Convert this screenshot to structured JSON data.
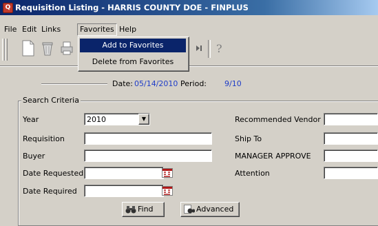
{
  "window": {
    "title": "Requisition Listing - HARRIS COUNTY DOE - FINPLUS",
    "app_icon": "finplus-app-icon"
  },
  "menubar": {
    "items": [
      "File",
      "Edit",
      "Links",
      "Favorites",
      "Help"
    ],
    "open_menu": "Favorites"
  },
  "favorites_menu": {
    "items": [
      "Add to Favorites",
      "Delete from Favorites"
    ],
    "highlighted": "Add to Favorites"
  },
  "toolbar": {
    "icons": [
      "new-document-icon",
      "trash-icon",
      "print-icon",
      "last-record-icon",
      "help-question-icon"
    ]
  },
  "info": {
    "date_label": "Date:",
    "date_value": "05/14/2010",
    "period_label": "Period:",
    "period_value": "9/10"
  },
  "search": {
    "group_title": "Search Criteria",
    "year_label": "Year",
    "year_value": "2010",
    "requisition_label": "Requisition",
    "requisition_value": "",
    "buyer_label": "Buyer",
    "buyer_value": "",
    "date_requested_label": "Date Requested",
    "date_requested_value": "",
    "date_required_label": "Date Required",
    "date_required_value": "",
    "vendor_label": "Recommended Vendor",
    "vendor_value": "",
    "ship_to_label": "Ship To",
    "ship_to_value": "",
    "manager_label": "MANAGER APPROVE",
    "manager_value": "",
    "attention_label": "Attention",
    "attention_value": ""
  },
  "buttons": {
    "find": "Find",
    "advanced": "Advanced"
  },
  "colors": {
    "title_bar": "#0a246a",
    "highlight": "#0a246a",
    "info_blue": "#1e3cc8",
    "face": "#d4d0c8"
  }
}
